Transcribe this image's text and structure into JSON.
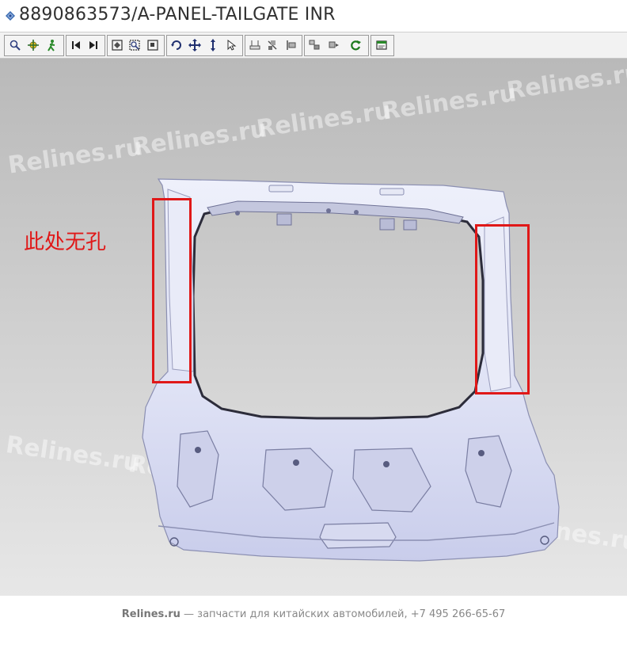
{
  "window": {
    "title": "8890863573/A-PANEL-TAILGATE INR",
    "title_icon": "part-icon"
  },
  "toolbar": {
    "groups": [
      {
        "name": "navigation",
        "buttons": [
          "zoom-icon",
          "pan-target-icon",
          "walk-icon"
        ]
      },
      {
        "name": "playback",
        "buttons": [
          "first-frame-icon",
          "last-frame-icon"
        ]
      },
      {
        "name": "fit",
        "buttons": [
          "fit-all-icon",
          "zoom-window-icon",
          "fit-selection-icon"
        ]
      },
      {
        "name": "view",
        "buttons": [
          "rotate-icon",
          "move-icon",
          "vertical-arrows-icon",
          "cursor-icon"
        ]
      },
      {
        "name": "measure",
        "buttons": [
          "measure-icon",
          "section-icon",
          "snap-icon"
        ]
      },
      {
        "name": "parts",
        "buttons": [
          "part-tree-icon",
          "part-move-icon",
          "refresh-icon"
        ]
      },
      {
        "name": "display",
        "buttons": [
          "window-icon"
        ]
      }
    ]
  },
  "viewport": {
    "annotation_text": "此处无孔",
    "annotation_color": "#e01818",
    "model_color": "#d9dcf2",
    "watermark_text": "Relines.ru"
  },
  "footer": {
    "brand": "Relines.ru",
    "text": " — запчасти для китайских автомобилей, +7 495 266-65-67"
  }
}
